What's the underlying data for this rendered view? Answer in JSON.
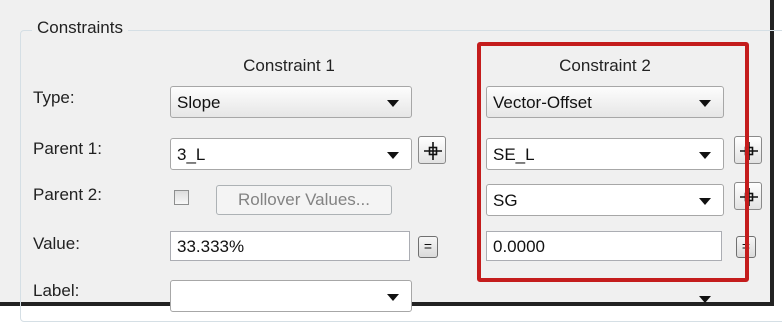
{
  "group": {
    "title": "Constraints"
  },
  "columns": {
    "constraint1": "Constraint 1",
    "constraint2": "Constraint 2"
  },
  "labels": {
    "type": "Type:",
    "parent1": "Parent 1:",
    "parent2": "Parent 2:",
    "value": "Value:",
    "label": "Label:"
  },
  "constraint1": {
    "type": "Slope",
    "parent1": "3_L",
    "rollover_checked": false,
    "rollover_button": "Rollover Values...",
    "value": "33.333%",
    "equals_label": "="
  },
  "constraint2": {
    "type": "Vector-Offset",
    "parent1": "SE_L",
    "parent2": "SG",
    "value": "0.0000",
    "equals_label": "="
  },
  "highlight_color": "#c41c1c",
  "icons": {
    "pick": "crosshair-target-icon",
    "dropdown": "chevron-down-icon"
  }
}
